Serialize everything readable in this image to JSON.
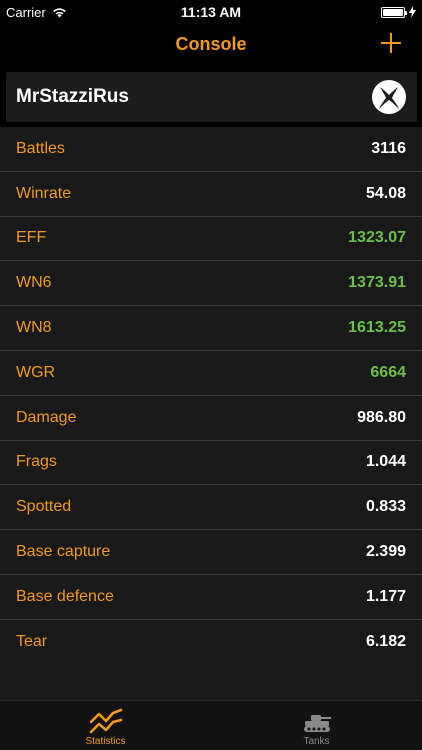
{
  "status_bar": {
    "carrier": "Carrier",
    "time": "11:13 AM"
  },
  "nav": {
    "title": "Console",
    "add_icon": "plus-icon"
  },
  "profile": {
    "username": "MrStazziRus",
    "platform_icon": "xbox-icon"
  },
  "stats": [
    {
      "label": "Battles",
      "value": "3116",
      "color": "#ffffff"
    },
    {
      "label": "Winrate",
      "value": "54.08",
      "color": "#ffffff"
    },
    {
      "label": "EFF",
      "value": "1323.07",
      "color": "#6cc04a"
    },
    {
      "label": "WN6",
      "value": "1373.91",
      "color": "#6cc04a"
    },
    {
      "label": "WN8",
      "value": "1613.25",
      "color": "#6cc04a"
    },
    {
      "label": "WGR",
      "value": "6664",
      "color": "#6cc04a"
    },
    {
      "label": "Damage",
      "value": "986.80",
      "color": "#ffffff"
    },
    {
      "label": "Frags",
      "value": "1.044",
      "color": "#ffffff"
    },
    {
      "label": "Spotted",
      "value": "0.833",
      "color": "#ffffff"
    },
    {
      "label": "Base capture",
      "value": "2.399",
      "color": "#ffffff"
    },
    {
      "label": "Base defence",
      "value": "1.177",
      "color": "#ffffff"
    },
    {
      "label": "Tear",
      "value": "6.182",
      "color": "#ffffff"
    }
  ],
  "tabs": [
    {
      "label": "Statistics",
      "icon": "chart-line-icon",
      "active": true
    },
    {
      "label": "Tanks",
      "icon": "tank-icon",
      "active": false
    }
  ],
  "colors": {
    "accent": "#f39a1e",
    "good": "#6cc04a",
    "background": "#000000",
    "row_background": "#191919"
  }
}
